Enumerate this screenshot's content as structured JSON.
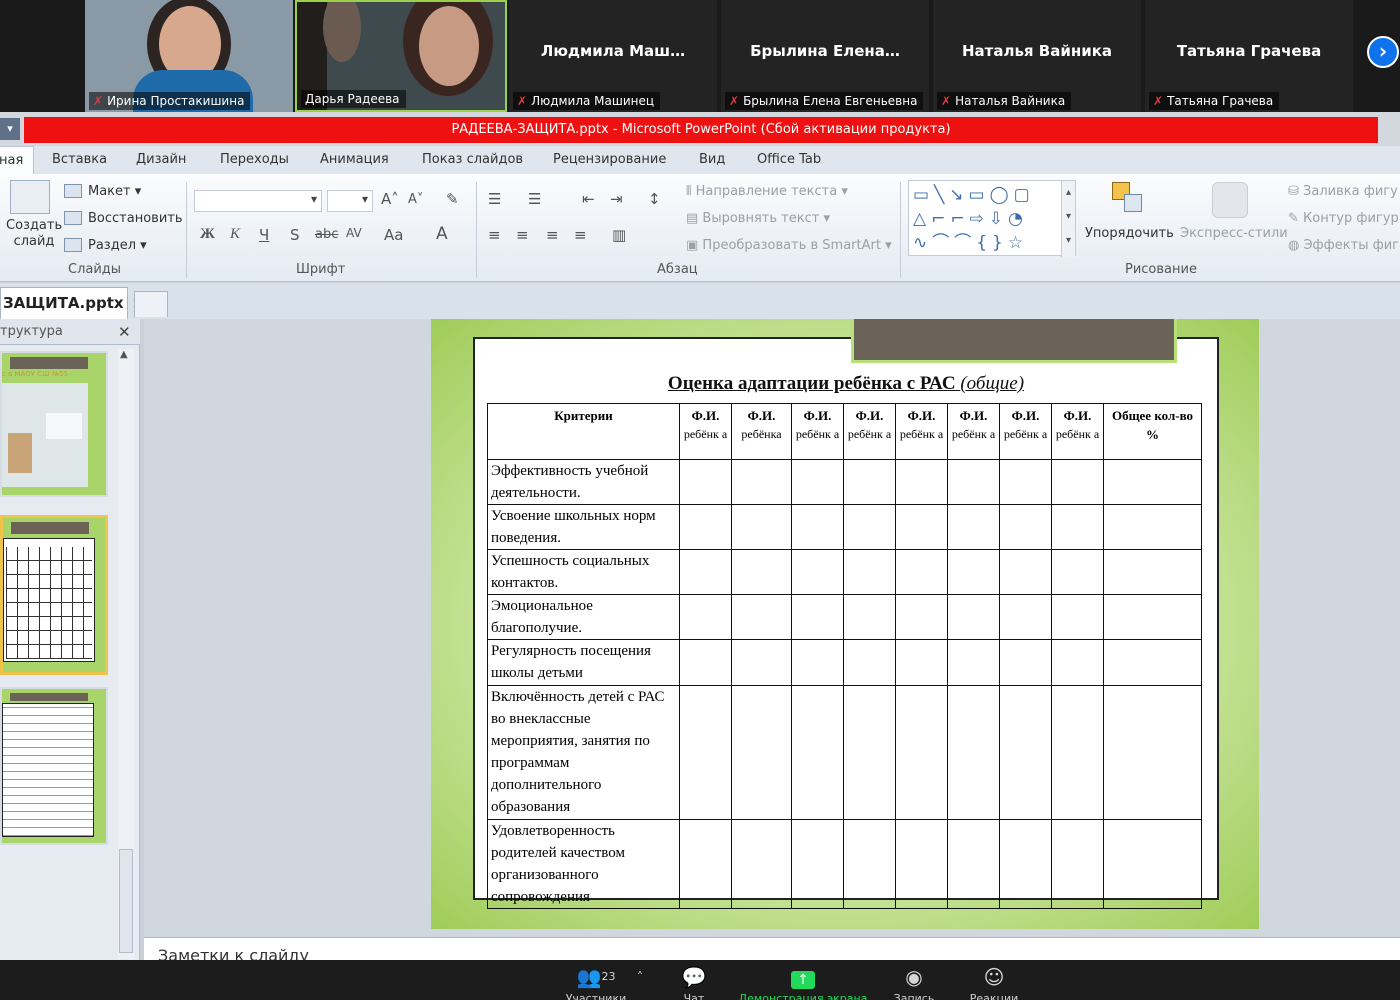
{
  "gallery": {
    "participants": [
      {
        "name": "Ирина Простакишина",
        "video": true
      },
      {
        "name": "Дарья Радеева",
        "video": true
      },
      {
        "display_name": "Людмила  Маш…",
        "name": "Людмила Машинец",
        "video": false
      },
      {
        "display_name": "Брылина  Елена…",
        "name": "Брылина Елена Евгеньевна",
        "video": false
      },
      {
        "display_name": "Наталья Вайника",
        "name": "Наталья Вайника",
        "video": false
      },
      {
        "display_name": "Татьяна Грачева",
        "name": "Татьяна Грачева",
        "video": false
      }
    ],
    "next_icon": "chevron-right-icon"
  },
  "ppt": {
    "window_title": "РАДЕЕВА-ЗАЩИТА.pptx  -  Microsoft PowerPoint (Сбой активации продукта)",
    "tabs": [
      "ная",
      "Вставка",
      "Дизайн",
      "Переходы",
      "Анимация",
      "Показ слайдов",
      "Рецензирование",
      "Вид",
      "Office Tab"
    ],
    "ribbon": {
      "slides_group": {
        "label": "Слайды",
        "new_slide": "Создать слайд",
        "layout": "Макет",
        "reset": "Восстановить",
        "section": "Раздел"
      },
      "font_group": {
        "label": "Шрифт",
        "bold": "Ж",
        "italic": "К",
        "underline": "Ч",
        "shadow": "S",
        "strike": "abc",
        "spacing": "AV",
        "case": "Aa",
        "color": "A"
      },
      "paragraph_group": {
        "label": "Абзац",
        "text_direction": "Направление текста",
        "align_text": "Выровнять текст",
        "smartart": "Преобразовать в SmartArt"
      },
      "drawing_group": {
        "label": "Рисование",
        "arrange": "Упорядочить",
        "quick_styles": "Экспресс-стили",
        "fill": "Заливка фигу",
        "outline": "Контур фигур",
        "effects": "Эффекты фиг"
      }
    },
    "doc_tab": "ЗАЩИТА.pptx",
    "pane_title": "труктура",
    "thumb1_caption": "с в МАОУ СШ №55",
    "notes_placeholder": "Заметки к слайду"
  },
  "slide": {
    "title": "Оценка адаптации ребёнка с РАС ",
    "title_sub": "(общие)",
    "table": {
      "header_criteria": "Критерии",
      "kid_headers": [
        {
          "top": "Ф.И.",
          "bottom": "ребёнк а"
        },
        {
          "top": "Ф.И.",
          "bottom": "ребёнка"
        },
        {
          "top": "Ф.И.",
          "bottom": "ребёнк а"
        },
        {
          "top": "Ф.И.",
          "bottom": "ребёнк а"
        },
        {
          "top": "Ф.И.",
          "bottom": "ребёнк а"
        },
        {
          "top": "Ф.И.",
          "bottom": "ребёнк а"
        },
        {
          "top": "Ф.И.",
          "bottom": "ребёнк а"
        },
        {
          "top": "Ф.И.",
          "bottom": "ребёнк а"
        }
      ],
      "header_total": "Общее кол-во %",
      "rows": [
        "Эффективность учебной деятельности.",
        "Усвоение школьных норм поведения.",
        "Успешность социальных контактов.",
        "Эмоциональное благополучие.",
        "Регулярность посещения школы детьми",
        "Включённость детей с РАС во внеклассные мероприятия, занятия по программам дополнительного образования",
        "Удовлетворенность родителей качеством организованного сопровождения"
      ]
    }
  },
  "zoom_toolbar": {
    "participants_count": "23",
    "items": [
      "Участники",
      "Чат",
      "Демонстрация экрана",
      "Запись",
      "Реакции"
    ],
    "share_color": "#23d959"
  }
}
